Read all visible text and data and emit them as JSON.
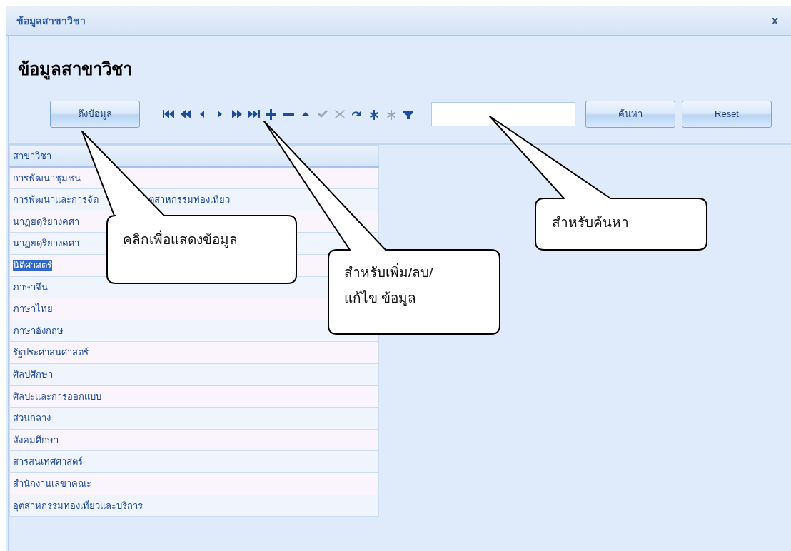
{
  "window": {
    "title": "ข้อมูลสาขาวิชา",
    "close": "x"
  },
  "heading": "ข้อมูลสาขาวิชา",
  "toolbar": {
    "load_button": "ดึงข้อมูล",
    "navigator": [
      {
        "kind": "first",
        "disabled": false
      },
      {
        "kind": "prev-page",
        "disabled": false
      },
      {
        "kind": "prev",
        "disabled": false
      },
      {
        "kind": "next",
        "disabled": false
      },
      {
        "kind": "next-page",
        "disabled": false
      },
      {
        "kind": "last",
        "disabled": false
      },
      {
        "kind": "add",
        "disabled": false
      },
      {
        "kind": "remove",
        "disabled": false
      },
      {
        "kind": "up",
        "disabled": false
      },
      {
        "kind": "check",
        "disabled": true
      },
      {
        "kind": "cancel",
        "disabled": true
      },
      {
        "kind": "refresh",
        "disabled": false
      },
      {
        "kind": "star",
        "disabled": false
      },
      {
        "kind": "star",
        "disabled": true
      },
      {
        "kind": "filter",
        "disabled": false
      }
    ],
    "search_button": "ค้นหา",
    "reset_button": "Reset"
  },
  "table": {
    "columns": [
      "สาขาวิชา"
    ],
    "rows": [
      {
        "text": "การพัฒนาชุมชน",
        "selected": false
      },
      {
        "text": "การพัฒนาและการจัด",
        "text_after": "ตสาหกรรมท่องเที่ยว",
        "selected": false
      },
      {
        "text": "นาฏยดุริยางคศา",
        "selected": false
      },
      {
        "text": "นาฏยดุริยางคศา",
        "selected": false
      },
      {
        "text": "นิติศาสตร์",
        "selected": true
      },
      {
        "text": "ภาษาจีน",
        "selected": false
      },
      {
        "text": "ภาษาไทย",
        "selected": false
      },
      {
        "text": "ภาษาอังกฤษ",
        "selected": false
      },
      {
        "text": "รัฐประศาสนศาสตร์",
        "selected": false
      },
      {
        "text": "ศิลปศึกษา",
        "selected": false
      },
      {
        "text": "ศิลปะและการออกแบบ",
        "selected": false
      },
      {
        "text": "ส่วนกลาง",
        "selected": false
      },
      {
        "text": "สังคมศึกษา",
        "selected": false
      },
      {
        "text": "สารสนเทศศาสตร์",
        "selected": false
      },
      {
        "text": "สำนักงานเลขาคณะ",
        "selected": false
      },
      {
        "text": "อุตสาหกรรมท่องเที่ยวและบริการ",
        "selected": false
      }
    ]
  },
  "callouts": [
    {
      "text": "คลิกเพื่อแสดงข้อมูล"
    },
    {
      "text": "สำหรับเพิ่ม/ลบ/แก้ไข ข้อมูล"
    },
    {
      "text": "สำหรับค้นหา"
    }
  ]
}
